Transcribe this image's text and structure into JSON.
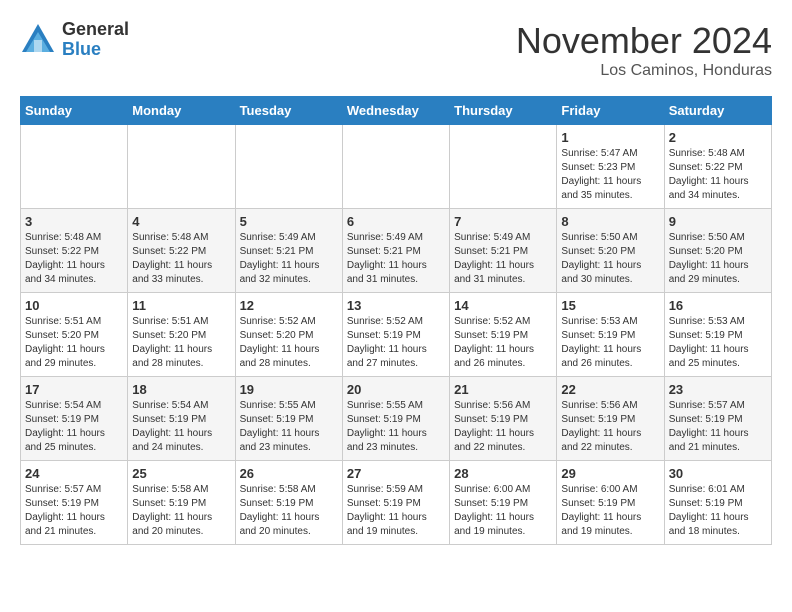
{
  "logo": {
    "general": "General",
    "blue": "Blue"
  },
  "title": "November 2024",
  "location": "Los Caminos, Honduras",
  "days_of_week": [
    "Sunday",
    "Monday",
    "Tuesday",
    "Wednesday",
    "Thursday",
    "Friday",
    "Saturday"
  ],
  "weeks": [
    [
      {
        "day": "",
        "info": ""
      },
      {
        "day": "",
        "info": ""
      },
      {
        "day": "",
        "info": ""
      },
      {
        "day": "",
        "info": ""
      },
      {
        "day": "",
        "info": ""
      },
      {
        "day": "1",
        "info": "Sunrise: 5:47 AM\nSunset: 5:23 PM\nDaylight: 11 hours\nand 35 minutes."
      },
      {
        "day": "2",
        "info": "Sunrise: 5:48 AM\nSunset: 5:22 PM\nDaylight: 11 hours\nand 34 minutes."
      }
    ],
    [
      {
        "day": "3",
        "info": "Sunrise: 5:48 AM\nSunset: 5:22 PM\nDaylight: 11 hours\nand 34 minutes."
      },
      {
        "day": "4",
        "info": "Sunrise: 5:48 AM\nSunset: 5:22 PM\nDaylight: 11 hours\nand 33 minutes."
      },
      {
        "day": "5",
        "info": "Sunrise: 5:49 AM\nSunset: 5:21 PM\nDaylight: 11 hours\nand 32 minutes."
      },
      {
        "day": "6",
        "info": "Sunrise: 5:49 AM\nSunset: 5:21 PM\nDaylight: 11 hours\nand 31 minutes."
      },
      {
        "day": "7",
        "info": "Sunrise: 5:49 AM\nSunset: 5:21 PM\nDaylight: 11 hours\nand 31 minutes."
      },
      {
        "day": "8",
        "info": "Sunrise: 5:50 AM\nSunset: 5:20 PM\nDaylight: 11 hours\nand 30 minutes."
      },
      {
        "day": "9",
        "info": "Sunrise: 5:50 AM\nSunset: 5:20 PM\nDaylight: 11 hours\nand 29 minutes."
      }
    ],
    [
      {
        "day": "10",
        "info": "Sunrise: 5:51 AM\nSunset: 5:20 PM\nDaylight: 11 hours\nand 29 minutes."
      },
      {
        "day": "11",
        "info": "Sunrise: 5:51 AM\nSunset: 5:20 PM\nDaylight: 11 hours\nand 28 minutes."
      },
      {
        "day": "12",
        "info": "Sunrise: 5:52 AM\nSunset: 5:20 PM\nDaylight: 11 hours\nand 28 minutes."
      },
      {
        "day": "13",
        "info": "Sunrise: 5:52 AM\nSunset: 5:19 PM\nDaylight: 11 hours\nand 27 minutes."
      },
      {
        "day": "14",
        "info": "Sunrise: 5:52 AM\nSunset: 5:19 PM\nDaylight: 11 hours\nand 26 minutes."
      },
      {
        "day": "15",
        "info": "Sunrise: 5:53 AM\nSunset: 5:19 PM\nDaylight: 11 hours\nand 26 minutes."
      },
      {
        "day": "16",
        "info": "Sunrise: 5:53 AM\nSunset: 5:19 PM\nDaylight: 11 hours\nand 25 minutes."
      }
    ],
    [
      {
        "day": "17",
        "info": "Sunrise: 5:54 AM\nSunset: 5:19 PM\nDaylight: 11 hours\nand 25 minutes."
      },
      {
        "day": "18",
        "info": "Sunrise: 5:54 AM\nSunset: 5:19 PM\nDaylight: 11 hours\nand 24 minutes."
      },
      {
        "day": "19",
        "info": "Sunrise: 5:55 AM\nSunset: 5:19 PM\nDaylight: 11 hours\nand 23 minutes."
      },
      {
        "day": "20",
        "info": "Sunrise: 5:55 AM\nSunset: 5:19 PM\nDaylight: 11 hours\nand 23 minutes."
      },
      {
        "day": "21",
        "info": "Sunrise: 5:56 AM\nSunset: 5:19 PM\nDaylight: 11 hours\nand 22 minutes."
      },
      {
        "day": "22",
        "info": "Sunrise: 5:56 AM\nSunset: 5:19 PM\nDaylight: 11 hours\nand 22 minutes."
      },
      {
        "day": "23",
        "info": "Sunrise: 5:57 AM\nSunset: 5:19 PM\nDaylight: 11 hours\nand 21 minutes."
      }
    ],
    [
      {
        "day": "24",
        "info": "Sunrise: 5:57 AM\nSunset: 5:19 PM\nDaylight: 11 hours\nand 21 minutes."
      },
      {
        "day": "25",
        "info": "Sunrise: 5:58 AM\nSunset: 5:19 PM\nDaylight: 11 hours\nand 20 minutes."
      },
      {
        "day": "26",
        "info": "Sunrise: 5:58 AM\nSunset: 5:19 PM\nDaylight: 11 hours\nand 20 minutes."
      },
      {
        "day": "27",
        "info": "Sunrise: 5:59 AM\nSunset: 5:19 PM\nDaylight: 11 hours\nand 19 minutes."
      },
      {
        "day": "28",
        "info": "Sunrise: 6:00 AM\nSunset: 5:19 PM\nDaylight: 11 hours\nand 19 minutes."
      },
      {
        "day": "29",
        "info": "Sunrise: 6:00 AM\nSunset: 5:19 PM\nDaylight: 11 hours\nand 19 minutes."
      },
      {
        "day": "30",
        "info": "Sunrise: 6:01 AM\nSunset: 5:19 PM\nDaylight: 11 hours\nand 18 minutes."
      }
    ]
  ]
}
